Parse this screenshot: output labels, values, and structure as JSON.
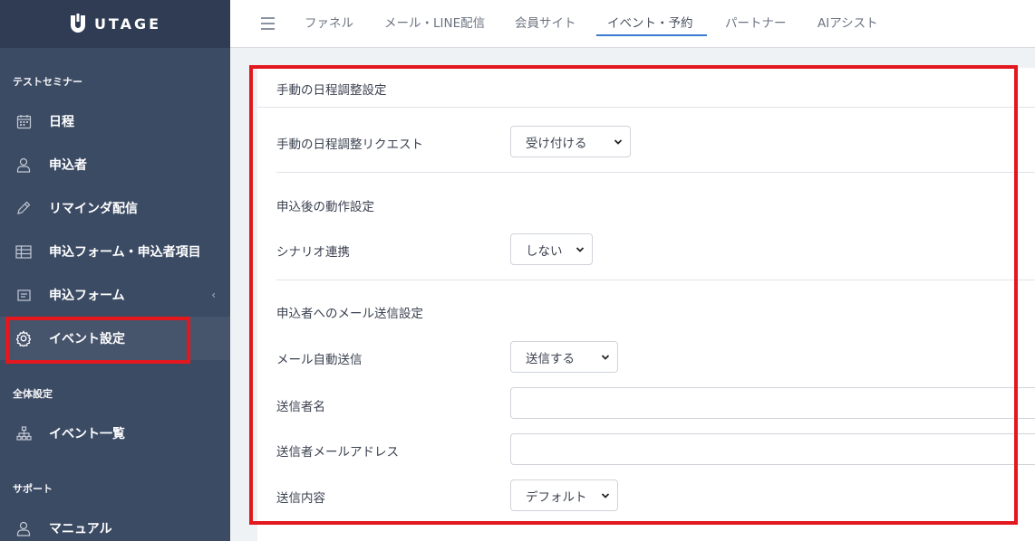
{
  "app": {
    "logo_text": "UTAGE"
  },
  "sidebar": {
    "section_event": "テストセミナー",
    "items_event": [
      {
        "label": "日程",
        "icon": "calendar-icon"
      },
      {
        "label": "申込者",
        "icon": "user-icon"
      },
      {
        "label": "リマインダ配信",
        "icon": "pencil-icon"
      },
      {
        "label": "申込フォーム・申込者項目",
        "icon": "table-icon"
      },
      {
        "label": "申込フォーム",
        "icon": "form-icon"
      },
      {
        "label": "イベント設定",
        "icon": "gear-icon"
      }
    ],
    "section_global": "全体設定",
    "items_global": [
      {
        "label": "イベント一覧",
        "icon": "sitemap-icon"
      }
    ],
    "section_support": "サポート",
    "items_support": [
      {
        "label": "マニュアル",
        "icon": "user-icon"
      }
    ]
  },
  "topnav": {
    "tabs": [
      "ファネル",
      "メール・LINE配信",
      "会員サイト",
      "イベント・予約",
      "パートナー",
      "AIアシスト"
    ],
    "active_tab": "イベント・予約"
  },
  "main": {
    "header": "手動の日程調整設定",
    "manual_request_label": "手動の日程調整リクエスト",
    "manual_request_value": "受け付ける",
    "after_apply_heading": "申込後の動作設定",
    "scenario_label": "シナリオ連携",
    "scenario_value": "しない",
    "mail_heading": "申込者へのメール送信設定",
    "auto_mail_label": "メール自動送信",
    "auto_mail_value": "送信する",
    "sender_name_label": "送信者名",
    "sender_name_value": "",
    "sender_email_label": "送信者メールアドレス",
    "sender_email_value": "",
    "content_label": "送信内容",
    "content_value": "デフォルト"
  },
  "colors": {
    "sidebar_bg": "#3c4b64",
    "highlight_box": "#e3181f",
    "tab_accent": "#3a7ad1"
  }
}
